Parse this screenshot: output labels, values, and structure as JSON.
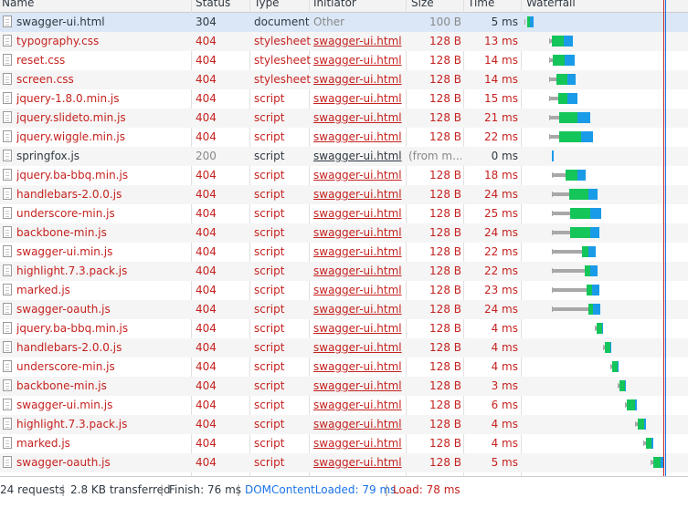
{
  "columns": {
    "name": "Name",
    "status": "Status",
    "type": "Type",
    "initiator": "Initiator",
    "size": "Size",
    "time": "Time",
    "waterfall": "Waterfall"
  },
  "rows": [
    {
      "name": "swagger-ui.html",
      "status": "304",
      "type": "document",
      "initiator": "Other",
      "size": "100 B",
      "time": "5 ms",
      "error": false
    },
    {
      "name": "typography.css",
      "status": "404",
      "type": "stylesheet",
      "initiator": "swagger-ui.html",
      "size": "128 B",
      "time": "13 ms",
      "error": true
    },
    {
      "name": "reset.css",
      "status": "404",
      "type": "stylesheet",
      "initiator": "swagger-ui.html",
      "size": "128 B",
      "time": "14 ms",
      "error": true
    },
    {
      "name": "screen.css",
      "status": "404",
      "type": "stylesheet",
      "initiator": "swagger-ui.html",
      "size": "128 B",
      "time": "14 ms",
      "error": true
    },
    {
      "name": "jquery-1.8.0.min.js",
      "status": "404",
      "type": "script",
      "initiator": "swagger-ui.html",
      "size": "128 B",
      "time": "15 ms",
      "error": true
    },
    {
      "name": "jquery.slideto.min.js",
      "status": "404",
      "type": "script",
      "initiator": "swagger-ui.html",
      "size": "128 B",
      "time": "21 ms",
      "error": true
    },
    {
      "name": "jquery.wiggle.min.js",
      "status": "404",
      "type": "script",
      "initiator": "swagger-ui.html",
      "size": "128 B",
      "time": "22 ms",
      "error": true
    },
    {
      "name": "springfox.js",
      "status": "200",
      "type": "script",
      "initiator": "swagger-ui.html",
      "size": "(from m...",
      "time": "0 ms",
      "error": false
    },
    {
      "name": "jquery.ba-bbq.min.js",
      "status": "404",
      "type": "script",
      "initiator": "swagger-ui.html",
      "size": "128 B",
      "time": "18 ms",
      "error": true
    },
    {
      "name": "handlebars-2.0.0.js",
      "status": "404",
      "type": "script",
      "initiator": "swagger-ui.html",
      "size": "128 B",
      "time": "24 ms",
      "error": true
    },
    {
      "name": "underscore-min.js",
      "status": "404",
      "type": "script",
      "initiator": "swagger-ui.html",
      "size": "128 B",
      "time": "25 ms",
      "error": true
    },
    {
      "name": "backbone-min.js",
      "status": "404",
      "type": "script",
      "initiator": "swagger-ui.html",
      "size": "128 B",
      "time": "24 ms",
      "error": true
    },
    {
      "name": "swagger-ui.min.js",
      "status": "404",
      "type": "script",
      "initiator": "swagger-ui.html",
      "size": "128 B",
      "time": "22 ms",
      "error": true
    },
    {
      "name": "highlight.7.3.pack.js",
      "status": "404",
      "type": "script",
      "initiator": "swagger-ui.html",
      "size": "128 B",
      "time": "22 ms",
      "error": true
    },
    {
      "name": "marked.js",
      "status": "404",
      "type": "script",
      "initiator": "swagger-ui.html",
      "size": "128 B",
      "time": "23 ms",
      "error": true
    },
    {
      "name": "swagger-oauth.js",
      "status": "404",
      "type": "script",
      "initiator": "swagger-ui.html",
      "size": "128 B",
      "time": "24 ms",
      "error": true
    },
    {
      "name": "jquery.ba-bbq.min.js",
      "status": "404",
      "type": "script",
      "initiator": "swagger-ui.html",
      "size": "128 B",
      "time": "4 ms",
      "error": true
    },
    {
      "name": "handlebars-2.0.0.js",
      "status": "404",
      "type": "script",
      "initiator": "swagger-ui.html",
      "size": "128 B",
      "time": "4 ms",
      "error": true
    },
    {
      "name": "underscore-min.js",
      "status": "404",
      "type": "script",
      "initiator": "swagger-ui.html",
      "size": "128 B",
      "time": "4 ms",
      "error": true
    },
    {
      "name": "backbone-min.js",
      "status": "404",
      "type": "script",
      "initiator": "swagger-ui.html",
      "size": "128 B",
      "time": "3 ms",
      "error": true
    },
    {
      "name": "swagger-ui.min.js",
      "status": "404",
      "type": "script",
      "initiator": "swagger-ui.html",
      "size": "128 B",
      "time": "6 ms",
      "error": true
    },
    {
      "name": "highlight.7.3.pack.js",
      "status": "404",
      "type": "script",
      "initiator": "swagger-ui.html",
      "size": "128 B",
      "time": "4 ms",
      "error": true
    },
    {
      "name": "marked.js",
      "status": "404",
      "type": "script",
      "initiator": "swagger-ui.html",
      "size": "128 B",
      "time": "4 ms",
      "error": true
    },
    {
      "name": "swagger-oauth.js",
      "status": "404",
      "type": "script",
      "initiator": "swagger-ui.html",
      "size": "128 B",
      "time": "5 ms",
      "error": true
    }
  ],
  "footer": {
    "requests": "24 requests",
    "transferred": "2.8 KB transferred",
    "finish": "Finish: 76 ms",
    "dcl": "DOMContentLoaded: 79 ms",
    "load": "Load: 78 ms"
  },
  "colors": {
    "error_text": "#c5221f",
    "waiting_green": "#14c55a",
    "download_blue": "#1a9be8",
    "queue_grey": "#a8a8a8",
    "dcl_line": "#1a73e8",
    "load_line": "#c5221f"
  }
}
